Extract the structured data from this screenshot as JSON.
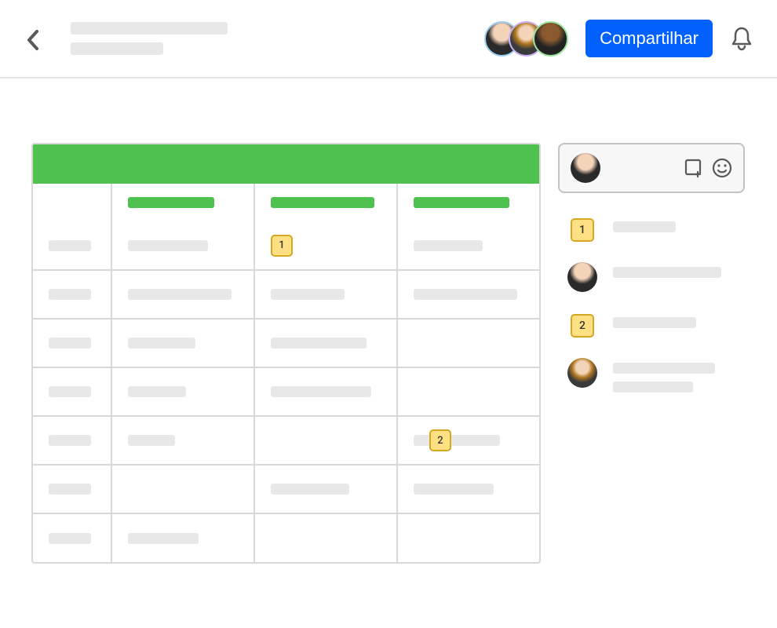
{
  "header": {
    "share_label": "Compartilhar",
    "collaborators": [
      {
        "id": "user-1",
        "ring": "#9ed0f2"
      },
      {
        "id": "user-2",
        "ring": "#cab0f4"
      },
      {
        "id": "user-3",
        "ring": "#9be29b"
      }
    ]
  },
  "sheet": {
    "banner_color": "#4ec14e",
    "header_widths": [
      110,
      132,
      122
    ],
    "rows": [
      {
        "c0": 54,
        "c1": 102,
        "c2": null,
        "c3": 88,
        "marker": {
          "col": 2,
          "id": "1"
        }
      },
      {
        "c0": 54,
        "c1": 132,
        "c2": 94,
        "c3": 132
      },
      {
        "c0": 54,
        "c1": 86,
        "c2": 122,
        "c3": null
      },
      {
        "c0": 54,
        "c1": 74,
        "c2": 128,
        "c3": null
      },
      {
        "c0": 54,
        "c1": 60,
        "c2": null,
        "c3": 110,
        "marker": {
          "col": 3,
          "id": "2",
          "x": 40
        }
      },
      {
        "c0": 54,
        "c1": null,
        "c2": 100,
        "c3": 102
      },
      {
        "c0": 54,
        "c1": 90,
        "c2": null,
        "c3": null
      }
    ]
  },
  "comments": [
    {
      "type": "marker",
      "id": "1",
      "line_widths": [
        80
      ]
    },
    {
      "type": "avatar",
      "avatar": "user-1",
      "line_widths": [
        138
      ]
    },
    {
      "type": "marker",
      "id": "2",
      "line_widths": [
        106
      ]
    },
    {
      "type": "avatar",
      "avatar": "user-2",
      "line_widths": [
        130,
        102
      ]
    }
  ],
  "composer": {
    "avatar": "user-1",
    "attach_icon": "attach-note-icon",
    "emoji_icon": "emoji-icon"
  }
}
